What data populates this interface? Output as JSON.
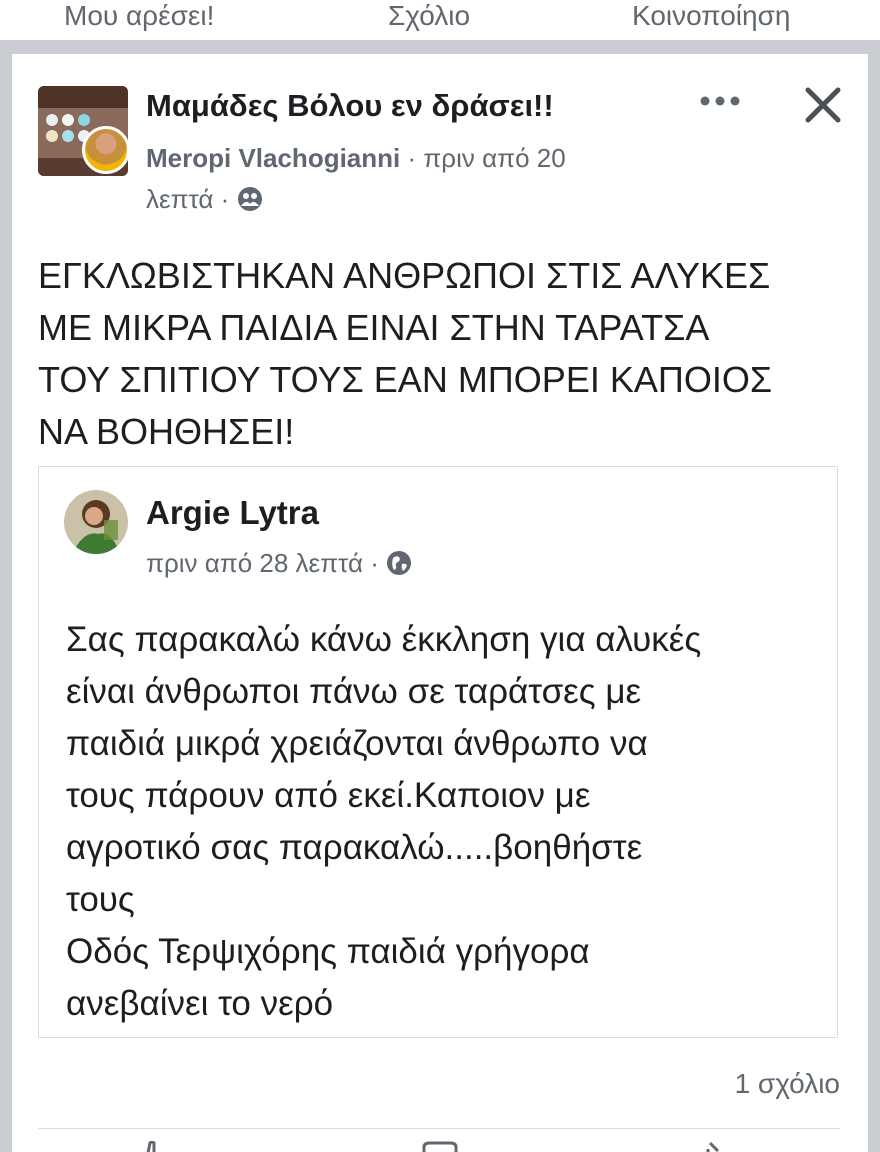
{
  "top_actions": {
    "like_label": "Μου αρέσει!",
    "comment_label": "Σχόλιο",
    "share_label": "Κοινοποίηση"
  },
  "post": {
    "group_name": "Μαμάδες Βόλου εν δράσει!!",
    "author": "Meropi Vlachogianni",
    "time_part1": "· πριν από 20",
    "time_part2": "λεπτά ·",
    "privacy_icon": "group-members-icon",
    "text_lines": [
      "ΕΓΚΛΩΒΙΣΤΗΚΑΝ ΑΝΘΡΩΠΟΙ ΣΤΙΣ ΑΛΥΚΕΣ",
      "ΜΕ ΜΙΚΡΑ ΠΑΙΔΙΑ ΕΙΝΑΙ ΣΤΗΝ ΤΑΡΑΤΣΑ",
      "ΤΟΥ ΣΠΙΤΙΟΥ ΤΟΥΣ ΕΑΝ ΜΠΟΡΕΙ ΚΑΠΟΙΟΣ",
      "ΝΑ ΒΟΗΘΗΣΕΙ!"
    ],
    "comment_count": "1 σχόλιο"
  },
  "shared_post": {
    "author": "Argie Lytra",
    "time": "πριν από 28 λεπτά ·",
    "privacy_icon": "globe-icon",
    "text_lines": [
      "Σας παρακαλώ κάνω έκκληση για αλυκές",
      "είναι άνθρωποι πάνω  σε ταράτσες με",
      "παιδιά μικρά χρειάζονται άνθρωπο να",
      "τους πάρουν από εκεί.Καποιον με",
      "αγροτικό σας παρακαλώ.....βοηθήστε",
      "τους",
      "Οδός Τερψιχόρης παιδιά γρήγορα",
      "ανεβαίνει το νερό"
    ]
  },
  "colors": {
    "text_primary": "#1c1e21",
    "text_secondary": "#606770",
    "separator": "#c9ccd1",
    "border": "#dadde1"
  }
}
